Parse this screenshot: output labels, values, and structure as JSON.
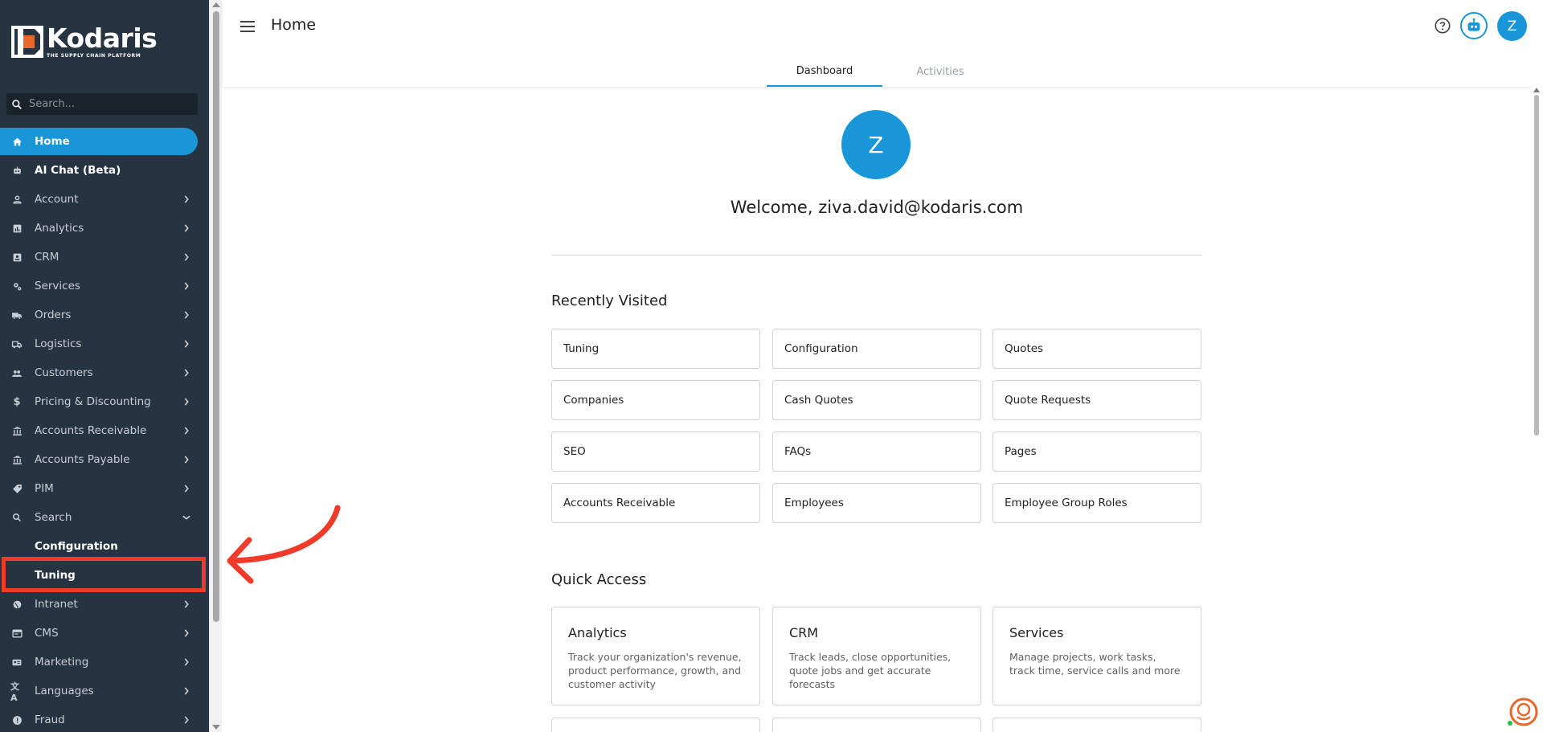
{
  "brand": {
    "name": "Kodaris",
    "tagline": "THE SUPPLY CHAIN PLATFORM"
  },
  "sidebar": {
    "search_placeholder": "Search...",
    "items": [
      {
        "label": "Home",
        "icon": "home-icon"
      },
      {
        "label": "AI Chat (Beta)",
        "icon": "robot-icon"
      },
      {
        "label": "Account",
        "icon": "person-icon"
      },
      {
        "label": "Analytics",
        "icon": "analytics-icon"
      },
      {
        "label": "CRM",
        "icon": "contact-card-icon"
      },
      {
        "label": "Services",
        "icon": "gears-icon"
      },
      {
        "label": "Orders",
        "icon": "truck-icon"
      },
      {
        "label": "Logistics",
        "icon": "delivery-icon"
      },
      {
        "label": "Customers",
        "icon": "group-icon"
      },
      {
        "label": "Pricing & Discounting",
        "icon": "dollar-icon"
      },
      {
        "label": "Accounts Receivable",
        "icon": "bank-icon"
      },
      {
        "label": "Accounts Payable",
        "icon": "bank-icon"
      },
      {
        "label": "PIM",
        "icon": "tag-icon"
      },
      {
        "label": "Search",
        "icon": "search-icon"
      },
      {
        "label": "Intranet",
        "icon": "globe-icon"
      },
      {
        "label": "CMS",
        "icon": "browser-icon"
      },
      {
        "label": "Marketing",
        "icon": "marketing-icon"
      },
      {
        "label": "Languages",
        "icon": "translate-icon"
      },
      {
        "label": "Fraud",
        "icon": "alert-icon"
      }
    ],
    "search_children": [
      "Configuration",
      "Tuning"
    ]
  },
  "header": {
    "title": "Home",
    "tabs": [
      "Dashboard",
      "Activities"
    ],
    "avatar_initial": "Z",
    "accent": "#1896d8"
  },
  "welcome": {
    "avatar_initial": "Z",
    "text": "Welcome, ziva.david@kodaris.com"
  },
  "recently_visited": {
    "title": "Recently Visited",
    "items": [
      "Tuning",
      "Configuration",
      "Quotes",
      "Companies",
      "Cash Quotes",
      "Quote Requests",
      "SEO",
      "FAQs",
      "Pages",
      "Accounts Receivable",
      "Employees",
      "Employee Group Roles"
    ]
  },
  "quick_access": {
    "title": "Quick Access",
    "items": [
      {
        "title": "Analytics",
        "desc": "Track your organization's revenue, product performance, growth, and customer activity"
      },
      {
        "title": "CRM",
        "desc": "Track leads, close opportunities, quote jobs and get accurate forecasts"
      },
      {
        "title": "Services",
        "desc": "Manage projects, work tasks, track time, service calls and more"
      }
    ]
  },
  "annotation_color": "#f03a2c"
}
